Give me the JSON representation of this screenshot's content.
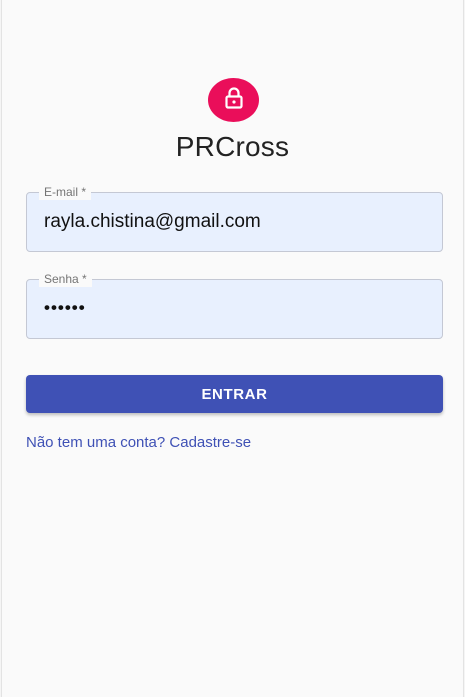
{
  "app": {
    "title": "PRCross"
  },
  "header": {
    "icon": "lock-icon"
  },
  "form": {
    "email": {
      "label": "E-mail *",
      "value": "rayla.chistina@gmail.com"
    },
    "password": {
      "label": "Senha *",
      "value": "••••••"
    },
    "submit_label": "ENTRAR",
    "signup_link": "Não tem uma conta? Cadastre-se"
  },
  "colors": {
    "accent": "#3f51b5",
    "avatar": "#ea0e5a",
    "input_background": "#e8f0fe"
  }
}
